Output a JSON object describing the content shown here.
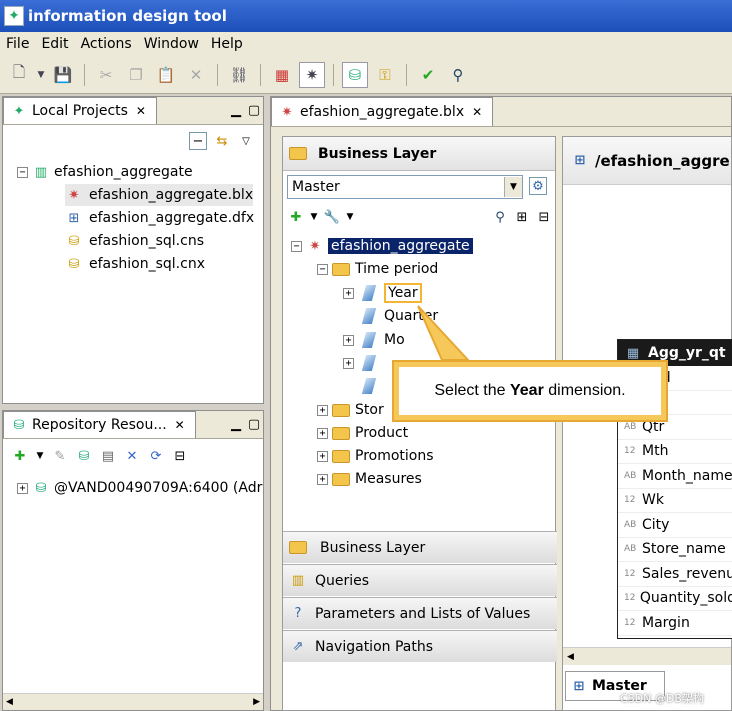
{
  "app": {
    "title": "information design tool"
  },
  "menu": [
    "File",
    "Edit",
    "Actions",
    "Window",
    "Help"
  ],
  "local_projects": {
    "tab_label": "Local Projects",
    "root": "efashion_aggregate",
    "files": [
      "efashion_aggregate.blx",
      "efashion_aggregate.dfx",
      "efashion_sql.cns",
      "efashion_sql.cnx"
    ]
  },
  "repository": {
    "tab_label": "Repository Resou...",
    "server": "@VAND00490709A:6400 (Adr"
  },
  "editor_tab": {
    "label": "efashion_aggregate.blx"
  },
  "business_layer": {
    "header": "Business Layer",
    "view_select": "Master",
    "root": "efashion_aggregate",
    "time_period": "Time period",
    "dims": [
      "Year",
      "Quarter",
      "Mo",
      "",
      ""
    ],
    "folders": [
      "Stor",
      "Product",
      "Promotions",
      "Measures"
    ]
  },
  "callout": {
    "pre": "Select the ",
    "bold": "Year",
    "post": " dimension."
  },
  "bottom_tabs": [
    "Business Layer",
    "Queries",
    "Parameters and Lists of Values",
    "Navigation Paths"
  ],
  "data_foundation": {
    "header": "/efashion_aggre",
    "table_title": "Agg_yr_qt",
    "columns": [
      {
        "type": "",
        "name": "1_id"
      },
      {
        "type": "",
        "name": ""
      },
      {
        "type": "AB",
        "name": "Qtr"
      },
      {
        "type": "12",
        "name": "Mth"
      },
      {
        "type": "AB",
        "name": "Month_name"
      },
      {
        "type": "12",
        "name": "Wk"
      },
      {
        "type": "AB",
        "name": "City"
      },
      {
        "type": "AB",
        "name": "Store_name"
      },
      {
        "type": "12",
        "name": "Sales_revenu"
      },
      {
        "type": "12",
        "name": "Quantity_sold"
      },
      {
        "type": "12",
        "name": "Margin"
      }
    ],
    "bottom_tab": "Master"
  },
  "watermark": "CSDN @DB架构"
}
